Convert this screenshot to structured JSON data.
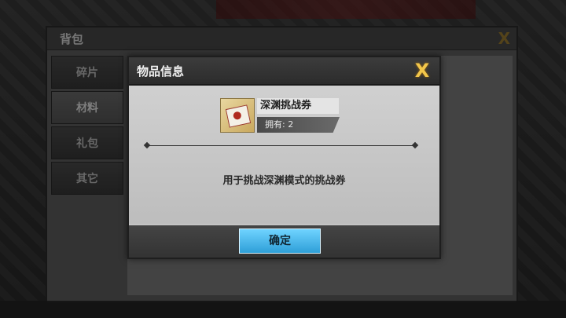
{
  "backpack": {
    "title": "背包",
    "close_glyph": "X",
    "tabs": [
      {
        "label": "碎片"
      },
      {
        "label": "材料",
        "active": true
      },
      {
        "label": "礼包"
      },
      {
        "label": "其它"
      }
    ]
  },
  "modal": {
    "title": "物品信息",
    "close_glyph": "X",
    "item": {
      "name": "深渊挑战券",
      "count_label": "拥有: 2",
      "icon": "ticket-icon"
    },
    "description": "用于挑战深渊模式的挑战券",
    "confirm_label": "确定"
  },
  "colors": {
    "accent": "#2e9fd8",
    "close": "#f2c64a"
  }
}
